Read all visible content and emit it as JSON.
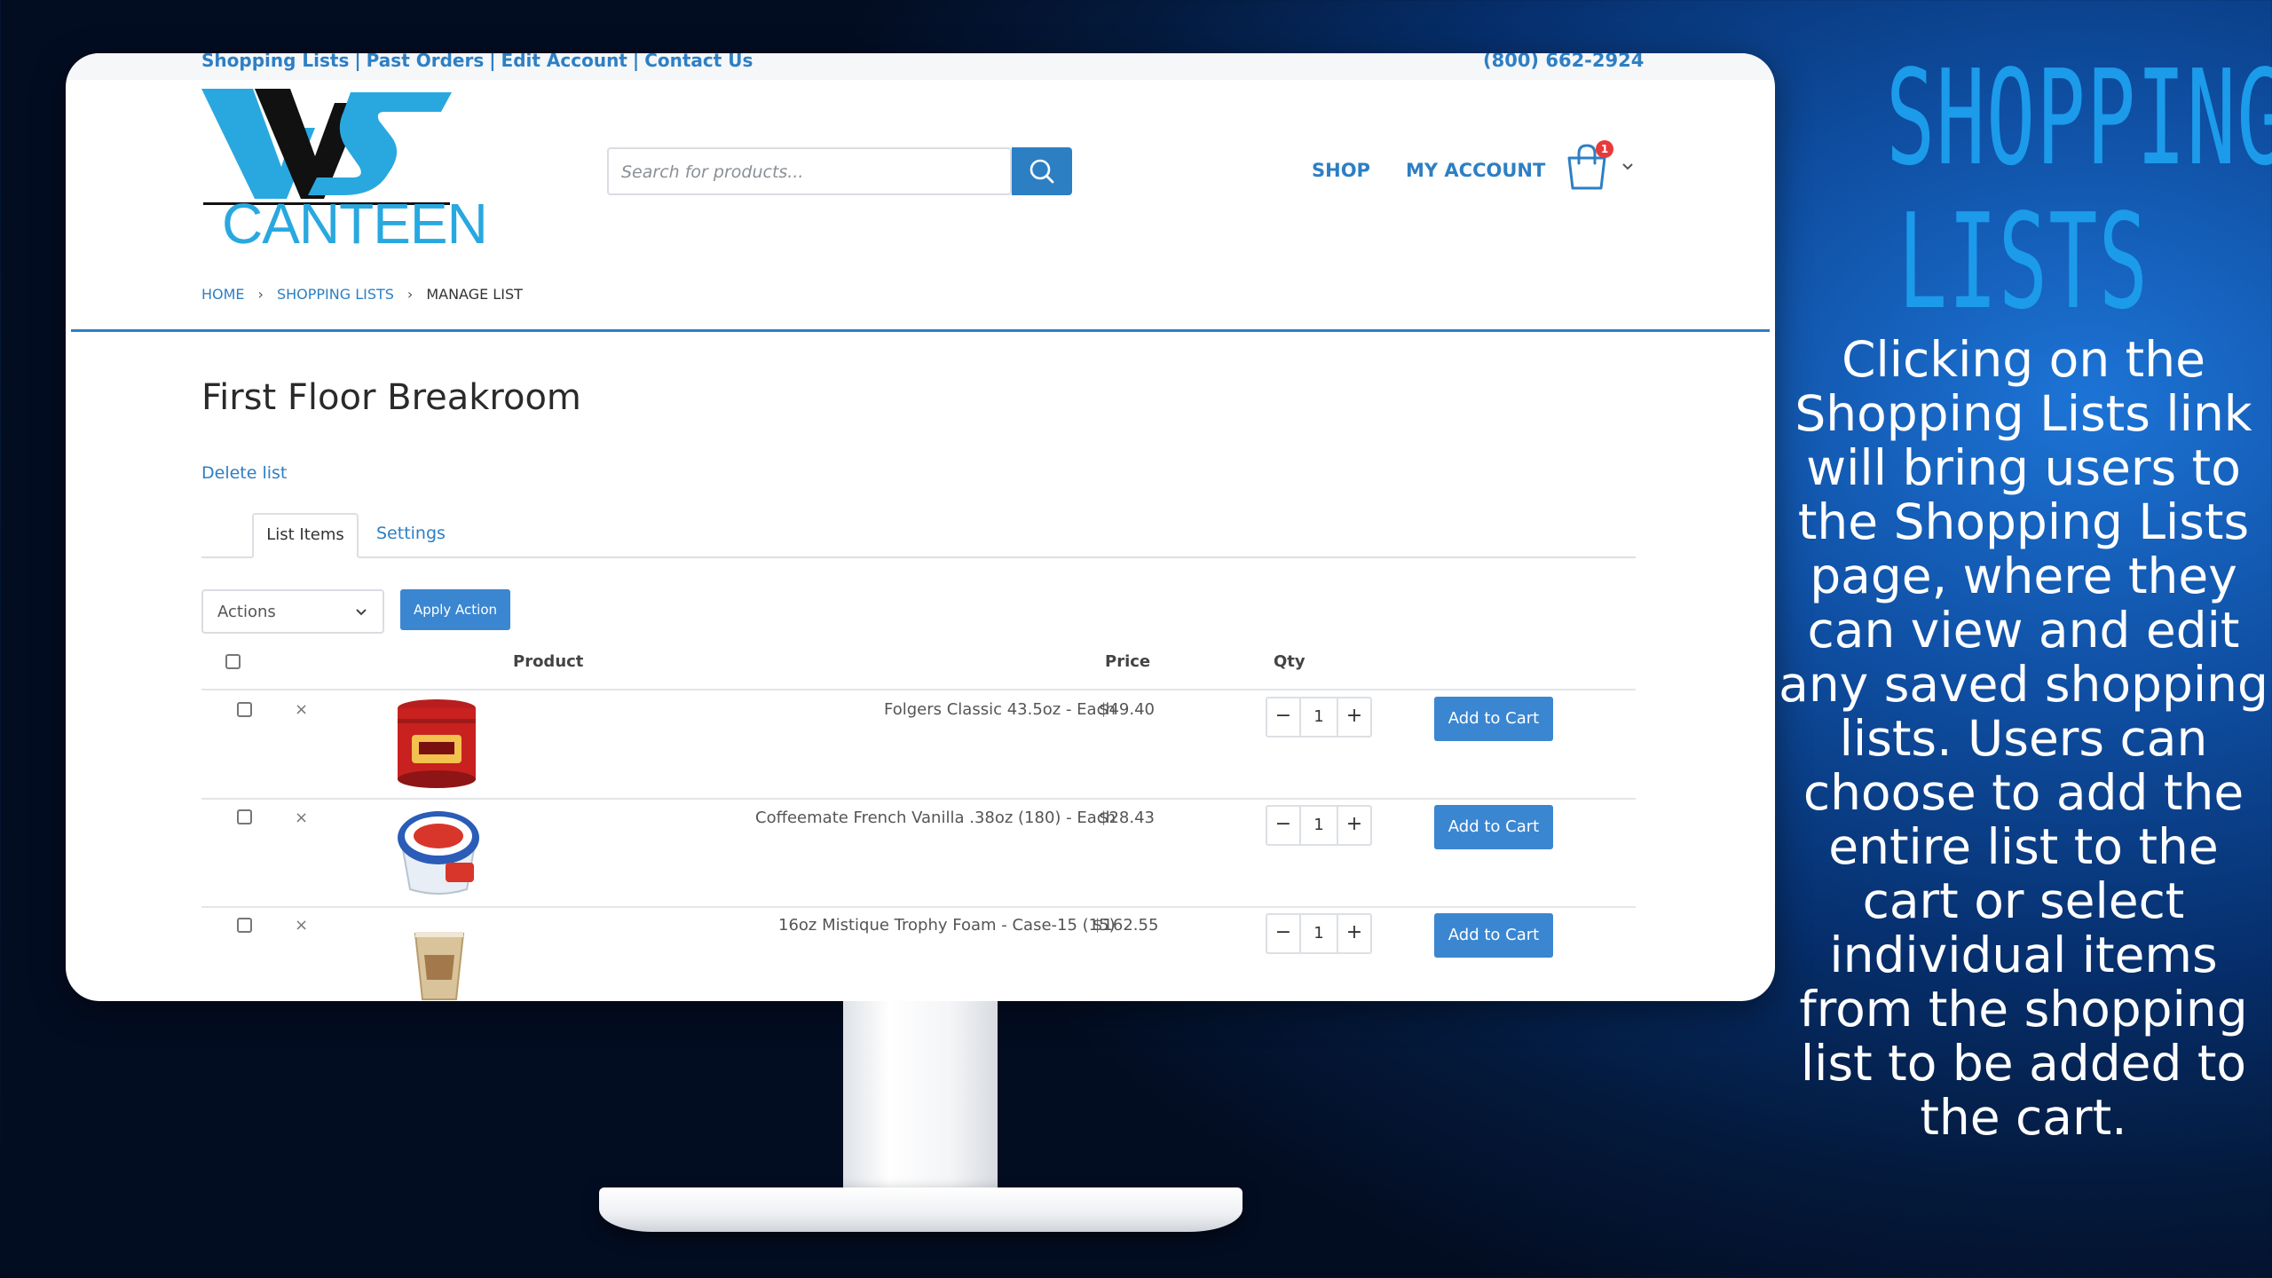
{
  "site": {
    "top_links": [
      "Shopping Lists",
      "Past Orders",
      "Edit Account",
      "Contact Us"
    ],
    "separator": "|",
    "phone": "(800) 662-2924",
    "logo_text": "CANTEEN",
    "search_placeholder": "Search for products...",
    "nav": {
      "shop": "SHOP",
      "my_account": "MY ACCOUNT"
    },
    "cart_count": "1",
    "breadcrumb": {
      "home": "HOME",
      "shopping_lists": "SHOPPING LISTS",
      "current": "MANAGE LIST",
      "separator": "›"
    },
    "page_title": "First Floor Breakroom",
    "delete_link": "Delete list",
    "tabs": {
      "list_items": "List Items",
      "settings": "Settings"
    },
    "actions": {
      "select_label": "Actions",
      "apply_button": "Apply Action"
    },
    "columns": {
      "product": "Product",
      "price": "Price",
      "qty": "Qty"
    },
    "rows": [
      {
        "product": "Folgers Classic 43.5oz - Each",
        "price": "$49.40",
        "qty": "1",
        "add_button": "Add to Cart",
        "remove": "×",
        "minus": "−",
        "plus": "+"
      },
      {
        "product": "Coffeemate French Vanilla .38oz (180) - Each",
        "price": "$28.43",
        "qty": "1",
        "add_button": "Add to Cart",
        "remove": "×",
        "minus": "−",
        "plus": "+"
      },
      {
        "product": "16oz Mistique Trophy Foam - Case-15 (15)",
        "price": "$162.55",
        "qty": "1",
        "add_button": "Add to Cart",
        "remove": "×",
        "minus": "−",
        "plus": "+"
      }
    ]
  },
  "panel": {
    "headline_line1": "SHOPPING",
    "headline_line2": "LISTS",
    "body": "Clicking on the Shopping Lists link will bring users to the Shopping Lists page, where they can view and edit any saved shopping lists. Users can choose to add the entire list to the cart or select individual items from the shopping list to be added to the cart."
  },
  "colors": {
    "accent": "#2d7fc4",
    "button": "#3b86d1",
    "headline": "#1c9bea",
    "badge": "#e83a3a"
  }
}
